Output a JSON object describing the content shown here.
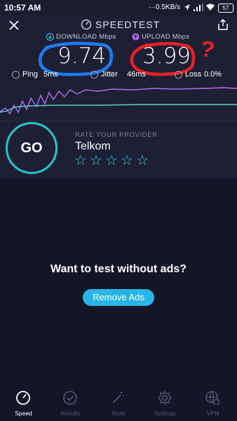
{
  "status_bar": {
    "time": "10:57 AM",
    "network": "0.5KB/s",
    "battery": "57"
  },
  "header": {
    "title": "SPEEDTEST",
    "close_icon": "close-icon",
    "share_icon": "share-icon"
  },
  "results": {
    "download_label": "DOWNLOAD Mbps",
    "download_value": "9.74",
    "upload_label": "UPLOAD Mbps",
    "upload_value": "3.99",
    "ping_label": "Ping",
    "ping_value": "5ms",
    "jitter_label": "Jitter",
    "jitter_value": "46ms",
    "loss_label": "Loss",
    "loss_value": "0.0%"
  },
  "annotations": {
    "question_mark": "?"
  },
  "go_button": {
    "label": "GO"
  },
  "rating": {
    "label": "RATE YOUR PROVIDER",
    "provider": "Telkom",
    "stars": 5
  },
  "ad": {
    "title": "Want to test without ads?",
    "button_label": "Remove Ads"
  },
  "nav": [
    {
      "label": "Speed",
      "icon": "speedometer-icon",
      "active": true
    },
    {
      "label": "Results",
      "icon": "check-circle-icon",
      "active": false
    },
    {
      "label": "Tools",
      "icon": "magic-wand-icon",
      "active": false
    },
    {
      "label": "Settings",
      "icon": "gear-icon",
      "active": false
    },
    {
      "label": "VPN",
      "icon": "globe-lock-icon",
      "active": false
    }
  ],
  "colors": {
    "download_accent": "#3fc7f0",
    "upload_accent": "#b46cf0",
    "annotation_blue": "#1e7bf0",
    "annotation_red": "#e8202a",
    "go_ring": "#28c4cf"
  }
}
